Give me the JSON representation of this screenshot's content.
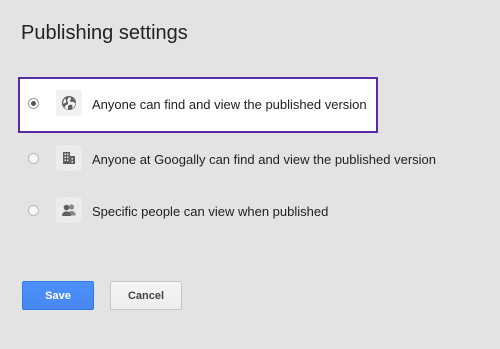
{
  "dialog": {
    "title": "Publishing settings"
  },
  "options": [
    {
      "label": "Anyone can find and view the published version",
      "icon": "globe-icon",
      "selected": true
    },
    {
      "label": "Anyone at Googally can find and view the published version",
      "icon": "building-icon",
      "selected": false
    },
    {
      "label": "Specific people can view when published",
      "icon": "people-icon",
      "selected": false
    }
  ],
  "buttons": {
    "save_label": "Save",
    "cancel_label": "Cancel"
  },
  "colors": {
    "background": "#e3e3e3",
    "selected_border": "#5b2aa8",
    "primary_button": "#4d90fe"
  }
}
